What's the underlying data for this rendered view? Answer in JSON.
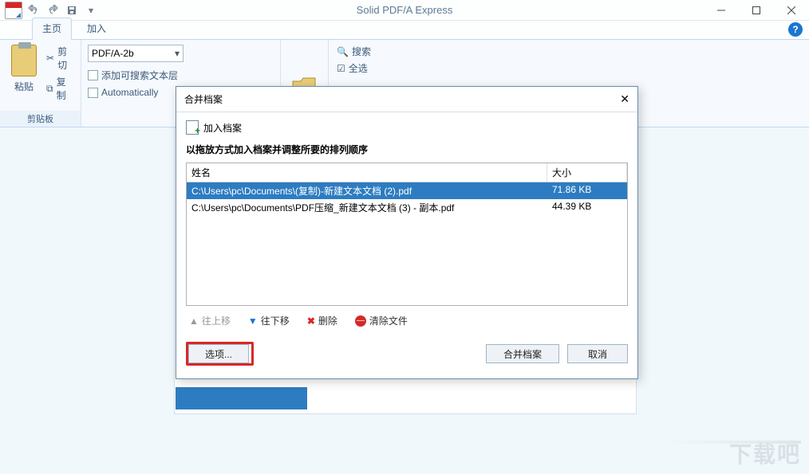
{
  "titlebar": {
    "app_title": "Solid PDF/A Express"
  },
  "tabs": {
    "home": "主页",
    "add": "加入"
  },
  "ribbon": {
    "clipboard_group": "剪贴板",
    "paste": "粘贴",
    "cut": "剪切",
    "copy": "复制",
    "pdf_mode": "PDF/A-2b",
    "add_text_layer": "添加可搜索文本层",
    "automatically": "Automatically",
    "search": "搜索",
    "select_all": "全选"
  },
  "dialog": {
    "title": "合并档案",
    "add_files": "加入档案",
    "heading": "以拖放方式加入档案并调整所要的排列顺序",
    "col_name": "姓名",
    "col_size": "大小",
    "rows": [
      {
        "name": "C:\\Users\\pc\\Documents\\(复制)-新建文本文档 (2).pdf",
        "size": "71.86 KB",
        "selected": true
      },
      {
        "name": "C:\\Users\\pc\\Documents\\PDF压缩_新建文本文档 (3) - 副本.pdf",
        "size": "44.39 KB",
        "selected": false
      }
    ],
    "move_up": "往上移",
    "move_down": "往下移",
    "delete": "删除",
    "clear_files": "清除文件",
    "options": "选项...",
    "merge": "合并档案",
    "cancel": "取消"
  },
  "watermark": "下载吧"
}
